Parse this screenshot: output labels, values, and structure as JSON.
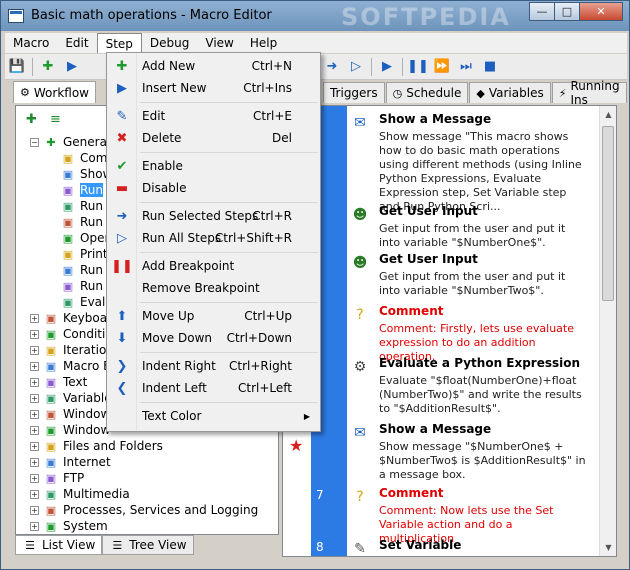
{
  "window": {
    "title": "Basic math operations - Macro Editor",
    "watermark": "SOFTPEDIA"
  },
  "menubar": [
    "Macro",
    "Edit",
    "Step",
    "Debug",
    "View",
    "Help"
  ],
  "tabs": [
    "Workflow",
    "Triggers",
    "Schedule",
    "Variables",
    "Running Ins"
  ],
  "tree": [
    {
      "label": "General",
      "level": 0,
      "expanded": true
    },
    {
      "label": "Com",
      "level": 1
    },
    {
      "label": "Show",
      "level": 1
    },
    {
      "label": "Run",
      "level": 1,
      "selected": true
    },
    {
      "label": "Run",
      "level": 1
    },
    {
      "label": "Run",
      "level": 1
    },
    {
      "label": "Open",
      "level": 1
    },
    {
      "label": "Print",
      "level": 1
    },
    {
      "label": "Run",
      "level": 1
    },
    {
      "label": "Run",
      "level": 1
    },
    {
      "label": "Eval",
      "level": 1
    },
    {
      "label": "Keyboard",
      "level": 0
    },
    {
      "label": "Condition",
      "level": 0
    },
    {
      "label": "Iterations",
      "level": 0
    },
    {
      "label": "Macro E",
      "level": 0
    },
    {
      "label": "Text",
      "level": 0
    },
    {
      "label": "Variables",
      "level": 0
    },
    {
      "label": "Window",
      "level": 0
    },
    {
      "label": "Window",
      "level": 0
    },
    {
      "label": "Files and Folders",
      "level": 0
    },
    {
      "label": "Internet",
      "level": 0
    },
    {
      "label": "FTP",
      "level": 0
    },
    {
      "label": "Multimedia",
      "level": 0
    },
    {
      "label": "Processes, Services and Logging",
      "level": 0
    },
    {
      "label": "System",
      "level": 0
    }
  ],
  "bottom_tabs": [
    "List View",
    "Tree View"
  ],
  "steps": [
    {
      "num": "",
      "title": "Show a Message",
      "desc": "Show message \"This macro shows how to do basic math operations using different methods (using Inline Python Expressions, Evaluate Expression step, Set Variable step and Run Python Scri...",
      "type": "normal",
      "icon": "message-icon"
    },
    {
      "num": "",
      "title": "Get User Input",
      "desc": "Get input from the user and put it into variable \"$NumberOne$\".",
      "type": "normal",
      "icon": "user-input-icon"
    },
    {
      "num": "",
      "title": "Get User Input",
      "desc": "Get input from the user and put it into variable \"$NumberTwo$\".",
      "type": "normal",
      "icon": "user-input-icon"
    },
    {
      "num": "",
      "title": "Comment",
      "desc": "Comment: Firstly, lets use evaluate expression to do an addition operation.",
      "type": "comment",
      "icon": "comment-icon"
    },
    {
      "num": "",
      "title": "Evaluate a Python Expression",
      "desc": "Evaluate \"$float(NumberOne)+float (NumberTwo)$\" and write the results to \"$AdditionResult$\".",
      "type": "normal",
      "icon": "python-icon"
    },
    {
      "num": "",
      "title": "Show a Message",
      "desc": "Show message \"$NumberOne$ + $NumberTwo$ is $AdditionResult$\" in a message box.",
      "type": "normal",
      "icon": "message-icon"
    },
    {
      "num": "7",
      "title": "Comment",
      "desc": "Comment: Now lets use the Set Variable action and do a multiplication",
      "type": "comment",
      "icon": "comment-icon"
    },
    {
      "num": "8",
      "title": "Set Variable",
      "desc": "",
      "type": "normal",
      "icon": "set-variable-icon"
    }
  ],
  "step_menu": [
    {
      "label": "Add New",
      "shortcut": "Ctrl+N",
      "icon": "add-icon",
      "color": "#1f9a2d"
    },
    {
      "label": "Insert New",
      "shortcut": "Ctrl+Ins",
      "icon": "insert-icon",
      "color": "#1d5fbf"
    },
    {
      "sep": true
    },
    {
      "label": "Edit",
      "shortcut": "Ctrl+E",
      "icon": "edit-icon",
      "color": "#1d5fbf"
    },
    {
      "label": "Delete",
      "shortcut": "Del",
      "icon": "delete-icon",
      "color": "#d62020"
    },
    {
      "sep": true
    },
    {
      "label": "Enable",
      "shortcut": "",
      "icon": "enable-icon",
      "color": "#1f9a2d"
    },
    {
      "label": "Disable",
      "shortcut": "",
      "icon": "disable-icon",
      "color": "#d62020"
    },
    {
      "sep": true
    },
    {
      "label": "Run Selected Steps",
      "shortcut": "Ctrl+R",
      "icon": "run-selected-icon",
      "color": "#1d5fbf"
    },
    {
      "label": "Run All Steps",
      "shortcut": "Ctrl+Shift+R",
      "icon": "run-all-icon",
      "color": "#1d5fbf"
    },
    {
      "sep": true
    },
    {
      "label": "Add Breakpoint",
      "shortcut": "",
      "icon": "breakpoint-icon",
      "color": "#d62020"
    },
    {
      "label": "Remove Breakpoint",
      "shortcut": "",
      "icon": "",
      "color": ""
    },
    {
      "sep": true
    },
    {
      "label": "Move Up",
      "shortcut": "Ctrl+Up",
      "icon": "move-up-icon",
      "color": "#1d5fbf"
    },
    {
      "label": "Move Down",
      "shortcut": "Ctrl+Down",
      "icon": "move-down-icon",
      "color": "#1d5fbf"
    },
    {
      "sep": true
    },
    {
      "label": "Indent Right",
      "shortcut": "Ctrl+Right",
      "icon": "indent-right-icon",
      "color": "#1d5fbf"
    },
    {
      "label": "Indent Left",
      "shortcut": "Ctrl+Left",
      "icon": "indent-left-icon",
      "color": "#1d5fbf"
    },
    {
      "sep": true
    },
    {
      "label": "Text Color",
      "shortcut": "",
      "icon": "",
      "color": "",
      "submenu": true
    }
  ]
}
